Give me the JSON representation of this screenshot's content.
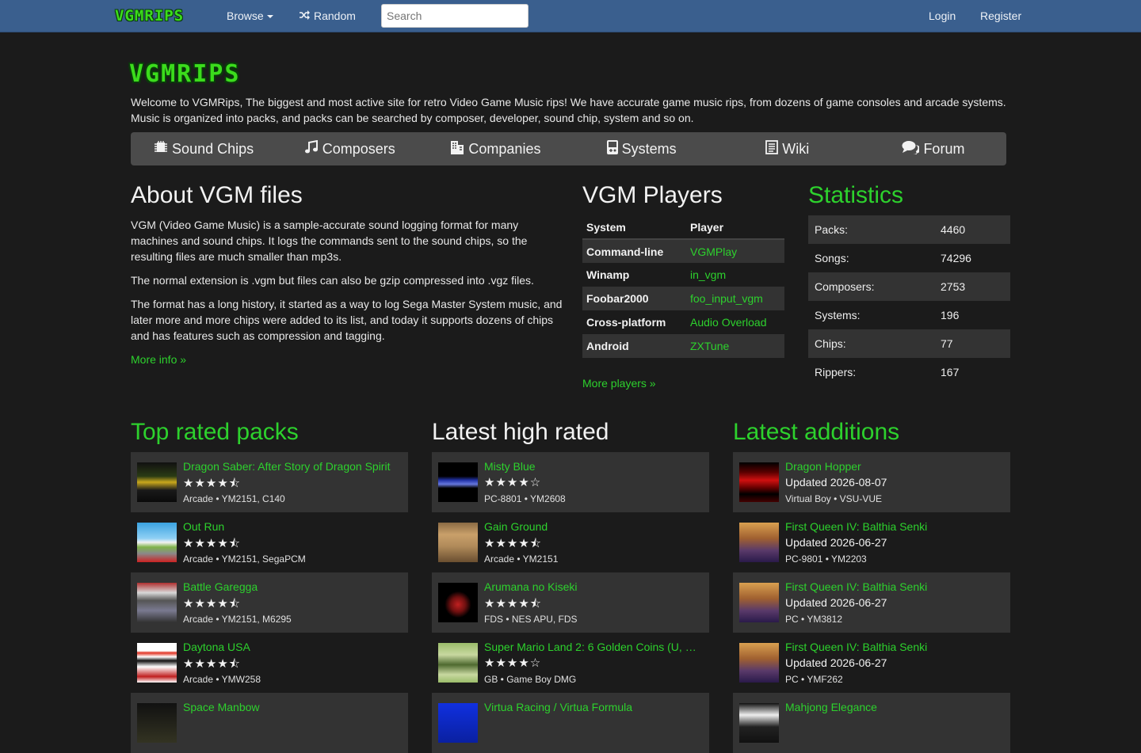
{
  "nav": {
    "logo": "VGMRIPS",
    "browse": "Browse",
    "random": "Random",
    "search_placeholder": "Search",
    "login": "Login",
    "register": "Register"
  },
  "hero": {
    "logo": "VGMRIPS",
    "intro": "Welcome to VGMRips, The biggest and most active site for retro Video Game Music rips! We have accurate game music rips, from dozens of game consoles and arcade systems. Music is organized into packs, and packs can be searched by composer, developer, sound chip, system and so on."
  },
  "linkbar": [
    {
      "label": "Sound Chips",
      "icon": "chip-icon"
    },
    {
      "label": "Composers",
      "icon": "music-icon"
    },
    {
      "label": "Companies",
      "icon": "building-icon"
    },
    {
      "label": "Systems",
      "icon": "gameboy-icon"
    },
    {
      "label": "Wiki",
      "icon": "book-icon"
    },
    {
      "label": "Forum",
      "icon": "comments-icon"
    }
  ],
  "about": {
    "title": "About VGM files",
    "paragraphs": [
      "VGM (Video Game Music) is a sample-accurate sound logging format for many machines and sound chips. It logs the commands sent to the sound chips, so the resulting files are much smaller than mp3s.",
      "The normal extension is .vgm but files can also be gzip compressed into .vgz files.",
      "The format has a long history, it started as a way to log Sega Master System music, and later more and more chips were added to its list, and today it supports dozens of chips and has features such as compression and tagging."
    ],
    "more": "More info »"
  },
  "players": {
    "title": "VGM Players",
    "headers": [
      "System",
      "Player"
    ],
    "rows": [
      {
        "system": "Command-line",
        "player": "VGMPlay"
      },
      {
        "system": "Winamp",
        "player": "in_vgm"
      },
      {
        "system": "Foobar2000",
        "player": "foo_input_vgm"
      },
      {
        "system": "Cross-platform",
        "player": "Audio Overload"
      },
      {
        "system": "Android",
        "player": "ZXTune"
      }
    ],
    "more": "More players »"
  },
  "statistics": {
    "title": "Statistics",
    "rows": [
      {
        "label": "Packs:",
        "value": "4460"
      },
      {
        "label": "Songs:",
        "value": "74296"
      },
      {
        "label": "Composers:",
        "value": "2753"
      },
      {
        "label": "Systems:",
        "value": "196"
      },
      {
        "label": "Chips:",
        "value": "77"
      },
      {
        "label": "Rippers:",
        "value": "167"
      }
    ]
  },
  "top_rated": {
    "title": "Top rated packs",
    "items": [
      {
        "title": "Dragon Saber: After Story of Dragon Spirit",
        "stars": "★★★★⯪",
        "meta": "Arcade • YM2151, C140",
        "rating": 4.5
      },
      {
        "title": "Out Run",
        "stars": "★★★★⯪",
        "meta": "Arcade • YM2151, SegaPCM",
        "rating": 4.5
      },
      {
        "title": "Battle Garegga",
        "stars": "★★★★⯪",
        "meta": "Arcade • YM2151, M6295",
        "rating": 4.5
      },
      {
        "title": "Daytona USA",
        "stars": "★★★★⯪",
        "meta": "Arcade • YMW258",
        "rating": 4.5
      },
      {
        "title": "Space Manbow",
        "stars": "",
        "meta": "",
        "rating": null
      }
    ]
  },
  "latest_high": {
    "title": "Latest high rated",
    "items": [
      {
        "title": "Misty Blue",
        "stars": "★★★★☆",
        "meta": "PC-8801 • YM2608",
        "rating": 4
      },
      {
        "title": "Gain Ground",
        "stars": "★★★★⯪",
        "meta": "Arcade • YM2151",
        "rating": 4.5
      },
      {
        "title": "Arumana no Kiseki",
        "stars": "★★★★⯪",
        "meta": "FDS • NES APU, FDS",
        "rating": 4.5
      },
      {
        "title": "Super Mario Land 2: 6 Golden Coins (U, …",
        "stars": "★★★★☆",
        "meta": "GB • Game Boy DMG",
        "rating": 4
      },
      {
        "title": "Virtua Racing / Virtua Formula",
        "stars": "",
        "meta": "",
        "rating": null
      }
    ]
  },
  "latest_additions": {
    "title": "Latest additions",
    "items": [
      {
        "title": "Dragon Hopper",
        "updated": "Updated 2026-08-07",
        "meta": "Virtual Boy • VSU-VUE"
      },
      {
        "title": "First Queen IV: Balthia Senki",
        "updated": "Updated 2026-06-27",
        "meta": "PC-9801 • YM2203"
      },
      {
        "title": "First Queen IV: Balthia Senki",
        "updated": "Updated 2026-06-27",
        "meta": "PC • YM3812"
      },
      {
        "title": "First Queen IV: Balthia Senki",
        "updated": "Updated 2026-06-27",
        "meta": "PC • YMF262"
      },
      {
        "title": "Mahjong Elegance",
        "updated": "",
        "meta": ""
      }
    ]
  }
}
